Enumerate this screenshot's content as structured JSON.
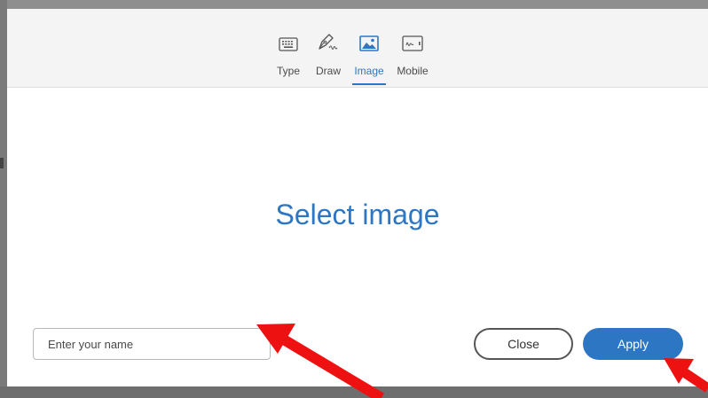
{
  "tabs": [
    {
      "label": "Type",
      "icon": "keyboard-icon",
      "active": false
    },
    {
      "label": "Draw",
      "icon": "pen-icon",
      "active": false
    },
    {
      "label": "Image",
      "icon": "image-icon",
      "active": true
    },
    {
      "label": "Mobile",
      "icon": "mobile-icon",
      "active": false
    }
  ],
  "main": {
    "select_image_label": "Select image"
  },
  "name_input": {
    "placeholder": "Enter your name",
    "value": ""
  },
  "buttons": {
    "close_label": "Close",
    "apply_label": "Apply"
  },
  "colors": {
    "accent": "#2d76c4",
    "annotation_arrow": "#ee1111",
    "backdrop": "#8e8e8e"
  }
}
